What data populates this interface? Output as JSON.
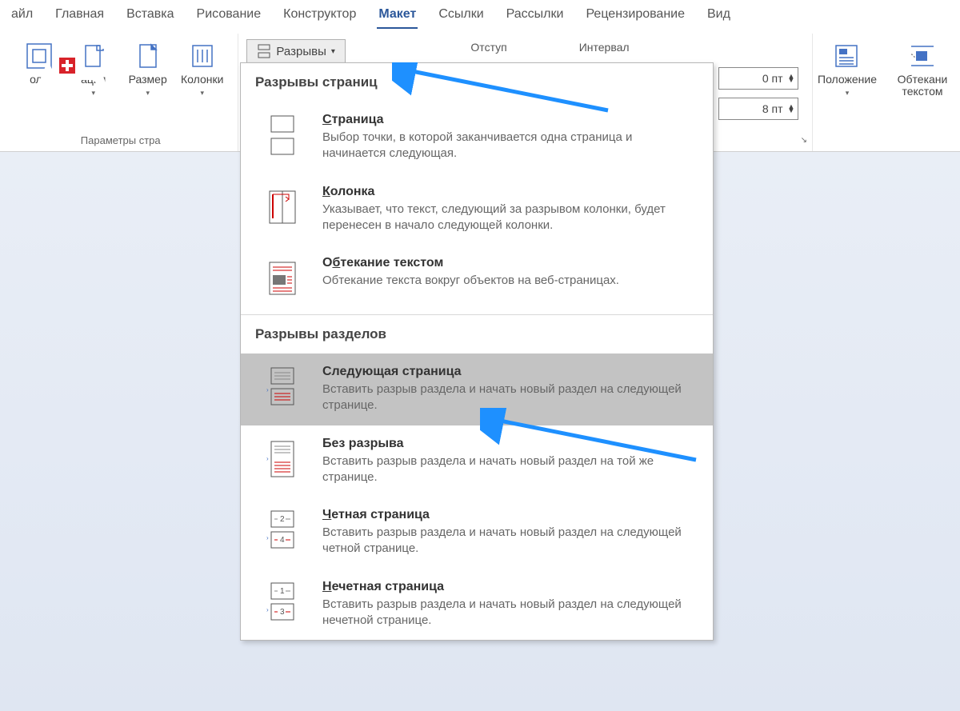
{
  "tabs": [
    {
      "label": "айл"
    },
    {
      "label": "Главная"
    },
    {
      "label": "Вставка"
    },
    {
      "label": "Рисование"
    },
    {
      "label": "Конструктор"
    },
    {
      "label": "Макет",
      "active": true
    },
    {
      "label": "Ссылки"
    },
    {
      "label": "Рассылки"
    },
    {
      "label": "Рецензирование"
    },
    {
      "label": "Вид"
    }
  ],
  "ribbon": {
    "page_setup_group_name": "Параметры стра",
    "margins": "оля",
    "orientation": "ация",
    "size": "Размер",
    "columns": "Колонки",
    "breaks_button": "Разрывы",
    "indent_label": "Отступ",
    "spacing_label": "Интервал",
    "spacing1": "0 пт",
    "spacing2": "8 пт",
    "arrange_position": "Положение",
    "arrange_wrap": "Обтекани\nтекстом"
  },
  "dropdown": {
    "sec1": "Разрывы страниц",
    "page_breaks": [
      {
        "title": "Страница",
        "pre": "С",
        "desc": "Выбор точки, в которой заканчивается одна страница и начинается следующая."
      },
      {
        "title": "Колонка",
        "pre": "К",
        "desc": "Указывает, что текст, следующий за разрывом колонки, будет перенесен в начало следующей колонки."
      },
      {
        "title": "Обтекание текстом",
        "pre": "б",
        "before": "О",
        "desc": "Обтекание текста вокруг объектов на веб-страницах."
      }
    ],
    "sec2": "Разрывы разделов",
    "section_breaks": [
      {
        "title": "Следующая страница",
        "pre": "",
        "desc": "Вставить разрыв раздела и начать новый раздел на следующей странице.",
        "hi": true
      },
      {
        "title": "Без разрыва",
        "pre": "",
        "desc": "Вставить разрыв раздела и начать новый раздел на той же странице."
      },
      {
        "title": "Четная страница",
        "pre": "Ч",
        "desc": "Вставить разрыв раздела и начать новый раздел на следующей четной странице."
      },
      {
        "title": "Нечетная страница",
        "pre": "Н",
        "desc": "Вставить разрыв раздела и начать новый раздел на следующей нечетной странице."
      }
    ]
  },
  "icons": {
    "caret": "▾"
  }
}
